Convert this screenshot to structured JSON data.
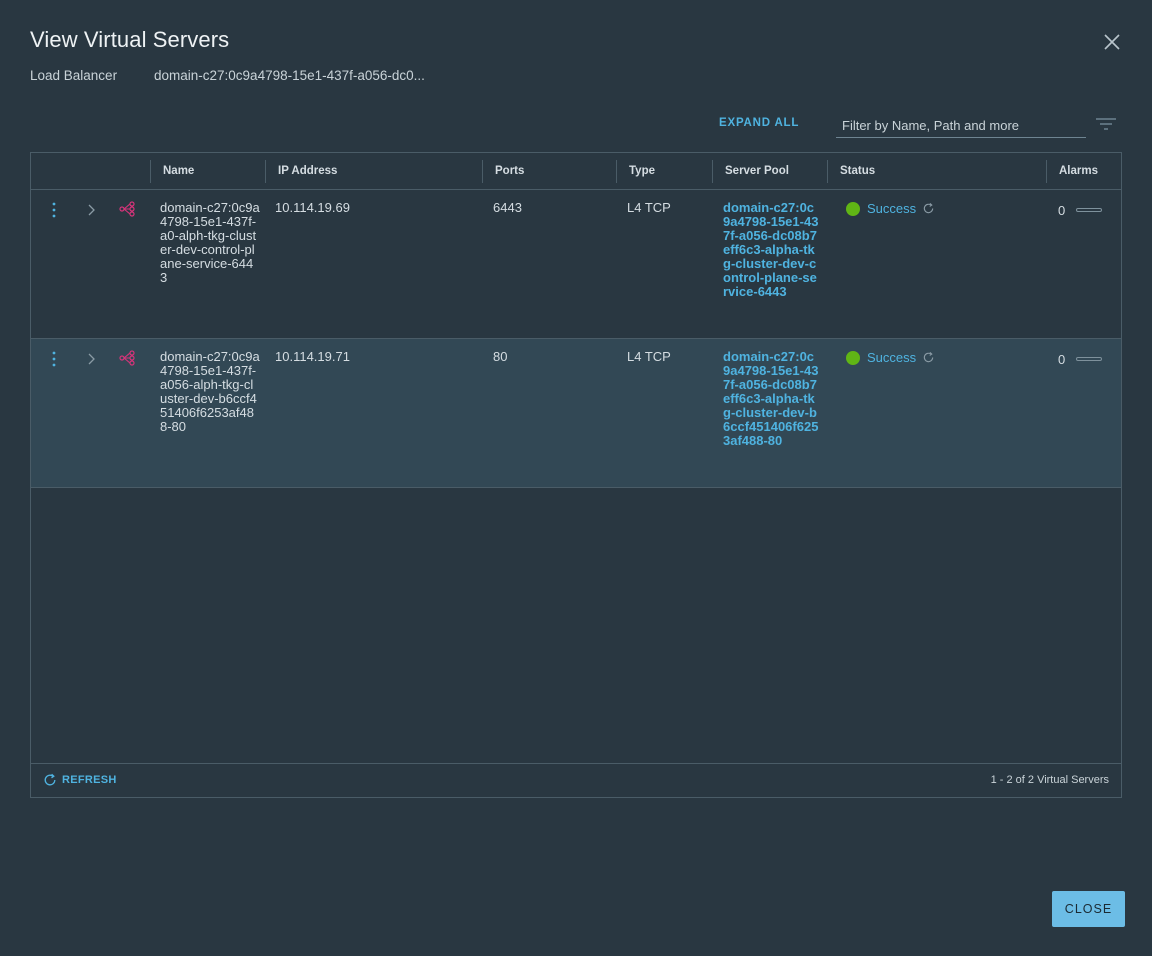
{
  "modal": {
    "title": "View Virtual Servers",
    "load_balancer_label": "Load Balancer",
    "load_balancer_value": "domain-c27:0c9a4798-15e1-437f-a056-dc0...",
    "expand_all": "EXPAND ALL",
    "filter_placeholder": "Filter by Name, Path and more",
    "close_button": "CLOSE"
  },
  "grid": {
    "columns": [
      "Name",
      "IP Address",
      "Ports",
      "Type",
      "Server Pool",
      "Status",
      "Alarms"
    ],
    "rows": [
      {
        "name": "domain-c27:0c9a4798-15e1-437f-a0-alph-tkg-cluster-dev-control-plane-service-6443",
        "ip": "10.114.19.69",
        "ports": "6443",
        "type": "L4 TCP",
        "server_pool": "domain-c27:0c9a4798-15e1-437f-a056-dc08b7eff6c3-alpha-tkg-cluster-dev-control-plane-service-6443",
        "status": "Success",
        "alarms": "0"
      },
      {
        "name": "domain-c27:0c9a4798-15e1-437f-a056-alph-tkg-cluster-dev-b6ccf451406f6253af488-80",
        "ip": "10.114.19.71",
        "ports": "80",
        "type": "L4 TCP",
        "server_pool": "domain-c27:0c9a4798-15e1-437f-a056-dc08b7eff6c3-alpha-tkg-cluster-dev-b6ccf451406f6253af488-80",
        "status": "Success",
        "alarms": "0"
      }
    ],
    "footer": {
      "refresh": "REFRESH",
      "pagination": "1 - 2 of 2 Virtual Servers"
    }
  },
  "colors": {
    "background": "#293741",
    "accent": "#4fb3e0",
    "success": "#60b515",
    "lb_icon": "#d6347a",
    "primary_button": "#6cbde6"
  },
  "icons": [
    "close-icon",
    "filter-icon",
    "more-vertical-icon",
    "chevron-right-icon",
    "load-balancer-icon",
    "refresh-icon"
  ]
}
